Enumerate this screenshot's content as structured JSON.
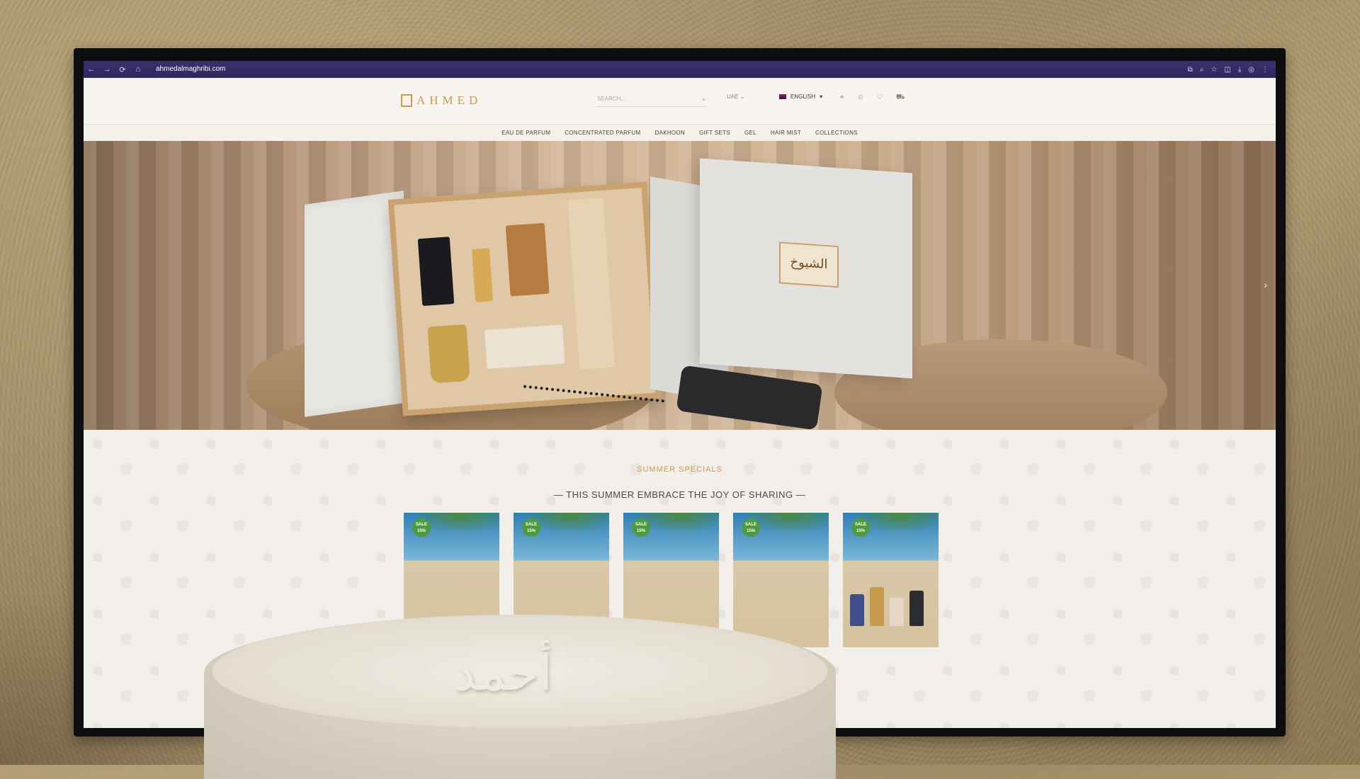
{
  "browser": {
    "url": "ahmedalmaghribi.com",
    "nav_icons": [
      "back-icon",
      "forward-icon",
      "reload-icon",
      "home-icon"
    ],
    "toolbar_icons": [
      "translate-icon",
      "zoom-icon",
      "star-icon",
      "extensions-icon",
      "download-icon",
      "profile-icon",
      "menu-icon"
    ]
  },
  "header": {
    "logo_text": "AHMED",
    "search_placeholder": "SEARCH...",
    "region": "UAE",
    "language": "ENGLISH",
    "accent_color": "#c79a55"
  },
  "nav": {
    "items": [
      "EAU DE PARFUM",
      "CONCENTRATED PARFUM",
      "DAKHOON",
      "GIFT SETS",
      "GEL",
      "HAIR MIST",
      "COLLECTIONS"
    ]
  },
  "hero": {
    "label_arabic": "الشيوخ"
  },
  "section": {
    "eyebrow": "SUMMER SPECIALS",
    "headline": "— THIS SUMMER EMBRACE THE JOY OF SHARING —",
    "products": [
      {
        "badge": "SALE 15%"
      },
      {
        "badge": "SALE 15%"
      },
      {
        "badge": "SALE 15%"
      },
      {
        "badge": "SALE 15%"
      },
      {
        "badge": "SALE 15%"
      }
    ]
  }
}
